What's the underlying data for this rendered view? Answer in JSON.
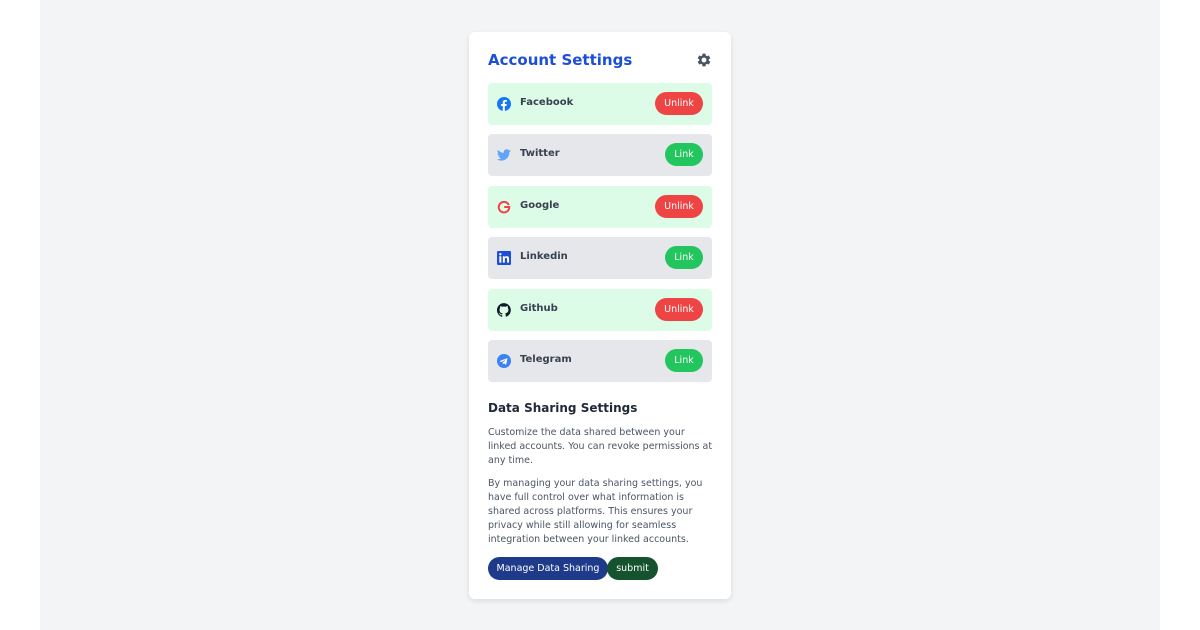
{
  "header": {
    "title": "Account Settings",
    "settings_icon": "gear-icon"
  },
  "accounts": [
    {
      "name": "Facebook",
      "icon": "facebook-icon",
      "status": "linked",
      "action": "Unlink",
      "icon_color": "#1877f2"
    },
    {
      "name": "Twitter",
      "icon": "twitter-icon",
      "status": "unlinked",
      "action": "Link",
      "icon_color": "#60a5fa"
    },
    {
      "name": "Google",
      "icon": "google-icon",
      "status": "linked",
      "action": "Unlink",
      "icon_color": "#ef4444"
    },
    {
      "name": "Linkedin",
      "icon": "linkedin-icon",
      "status": "unlinked",
      "action": "Link",
      "icon_color": "#1d4ed8"
    },
    {
      "name": "Github",
      "icon": "github-icon",
      "status": "linked",
      "action": "Unlink",
      "icon_color": "#111827"
    },
    {
      "name": "Telegram",
      "icon": "telegram-icon",
      "status": "unlinked",
      "action": "Link",
      "icon_color": "#3b82f6"
    }
  ],
  "data_sharing": {
    "title": "Data Sharing Settings",
    "paragraph1": "Customize the data shared between your linked accounts. You can revoke permissions at any time.",
    "paragraph2": "By managing your data sharing settings, you have full control over what information is shared across platforms. This ensures your privacy while still allowing for seamless integration between your linked accounts.",
    "manage_label": "Manage Data Sharing",
    "submit_label": "submit"
  },
  "colors": {
    "accent": "#1d4ed8",
    "linked_bg": "#dcfce7",
    "unlinked_bg": "#e5e7eb",
    "unlink_button": "#ef4444",
    "link_button": "#22c55e",
    "manage_button": "#1e3a8a",
    "submit_button": "#14532d"
  }
}
